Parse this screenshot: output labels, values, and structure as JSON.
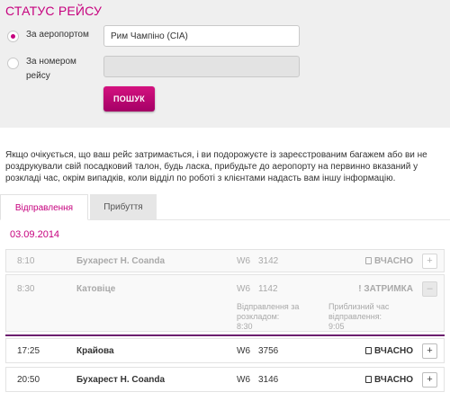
{
  "page_title": "СТАТУС РЕЙСУ",
  "search": {
    "by_airport_label": "За аеропортом",
    "by_flight_label": "За номером рейсу",
    "airport_value": "Рим Чампіно (CIA)",
    "flight_value": "",
    "search_button": "ПОШУК"
  },
  "info_text": "Якщо очікується, що ваш рейс затримається, і ви подорожуєте із зареєстрованим багажем або ви не роздрукували свій посадковий талон, будь ласка, прибудьте до аеропорту на первинно вказаний у розкладі час, окрім випадків, коли відділ по роботі з клієнтами надасть вам іншу інформацію.",
  "tabs": {
    "departures": "Відправлення",
    "arrivals": "Прибуття"
  },
  "date": "03.09.2014",
  "flights": [
    {
      "time": "8:10",
      "destination": "Бухарест Н. Coanda",
      "carrier": "W6",
      "number": "3142",
      "status": "ВЧАСНО",
      "toggle": "+"
    },
    {
      "time": "8:30",
      "destination": "Катовіце",
      "carrier": "W6",
      "number": "1142",
      "status": "! ЗАТРИМКА",
      "toggle": "–",
      "scheduled_label": "Відправлення за розкладом:",
      "scheduled_time": "8:30",
      "estimated_label": "Приблизний час відправлення:",
      "estimated_time": "9:05"
    },
    {
      "time": "17:25",
      "destination": "Крайова",
      "carrier": "W6",
      "number": "3756",
      "status": "ВЧАСНО",
      "toggle": "+"
    },
    {
      "time": "20:50",
      "destination": "Бухарест Н. Coanda",
      "carrier": "W6",
      "number": "3146",
      "status": "ВЧАСНО",
      "toggle": "+"
    }
  ],
  "colors": {
    "accent": "#c6007e",
    "divider": "#6b1e6e"
  }
}
